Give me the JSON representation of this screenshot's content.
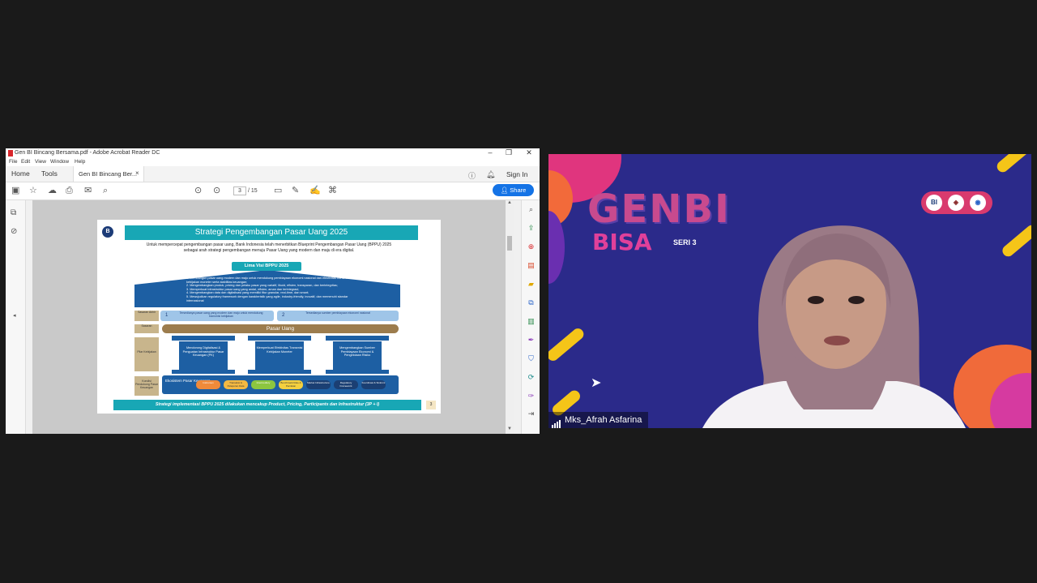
{
  "acrobat": {
    "window_title": "Gen BI Bincang Bersama.pdf - Adobe Acrobat Reader DC",
    "window_controls": {
      "minimize": "–",
      "restore": "❐",
      "close": "✕"
    },
    "menu": [
      "File",
      "Edit",
      "View",
      "Window",
      "Help"
    ],
    "tabs": {
      "home": "Home",
      "tools": "Tools",
      "document": "Gen BI Bincang Ber...",
      "close": "×"
    },
    "sign_in": "Sign In",
    "page": {
      "current": "3",
      "total": "/ 15"
    },
    "share_label": "Share",
    "accent_color": "#1473e6"
  },
  "slide": {
    "title": "Strategi Pengembangan Pasar Uang 2025",
    "intro_line1": "Untuk mempercepat pengembangan pasar uang, Bank Indonesia telah menerbitkan Blueprint Pengembangan Pasar Uang (BPPU) 2025",
    "intro_line2": "sebagai arah strategi pengembangan menuju Pasar Uang yang modern dan maju di era digital.",
    "visi_label": "Lima Visi BPPU 2025",
    "missions": [
      "1. Membangun pasar uang modern dan maju untuk mendukung pembiayaan ekonomi nasional dan efektivitas transmisi kebijakan moneter serta stabilitas keuangan;",
      "2. Mengembangkan produk, pricing dan pelaku pasar yang variatif, likuid, efisien, transparan, dan berintegritas;",
      "3. Memperkuat infrastruktur pasar uang yang andal, efisien, aman dan terintegrasi;",
      "4. Mengembangkan data dan digitalisasi yang memiliki fitur granular, real-time, dan smart;",
      "5. Mewujudkan regulatory framework dengan karakteristik yang agile, industry-friendly, inovatif, dan memenuhi standar internasional"
    ],
    "side_labels": {
      "outcome": "Sasaran Akhir",
      "target": "Sasaran",
      "pillars": "Pilar Kebijakan",
      "enablers": "Kondisi Pendukung Pasar Keuangan"
    },
    "outcome1_num": "1",
    "outcome1": "Tersedianya pasar uang yang modern dan maju untuk mendukung transmisi kebijakan",
    "outcome2_num": "2",
    "outcome2": "Tersedianya sumber pembiayaan ekonomi nasional",
    "pasar_uang": "Pasar Uang",
    "columns": [
      "Mendorong Digitalisasi & Penguatan Infrastruktur Pasar Keuangan (PK)",
      "Memperkuat Efektivitas Transmisi Kebijakan Moneter",
      "Mengembangkan Sumber Pembiayaan Ekonomi & Pengelolaan Risiko"
    ],
    "ecosystem_label": "Ekosistem Pasar Keuangan",
    "chips": [
      "Instrumen",
      "Transaksi & Pelaporan Data",
      "Intermediary",
      "Benchmark Rate & Penilaian",
      "Market Infrastructure",
      "Regulatory Framework",
      "Koordinasi & Sinkroni"
    ],
    "footer": "Strategi implementasi BPPU 2025 dilakukan mencakup Product, Pricing, Participants dan Infrastruktur  (3P + I)",
    "page_number": "3",
    "logo_text": "B"
  },
  "video": {
    "banner_top": "GENBI",
    "banner_bottom": "BISA",
    "series": "SERI 3",
    "participant_name": "Mks_Afrah Asfarina",
    "logos": [
      "BI",
      "◈",
      "◉"
    ]
  }
}
